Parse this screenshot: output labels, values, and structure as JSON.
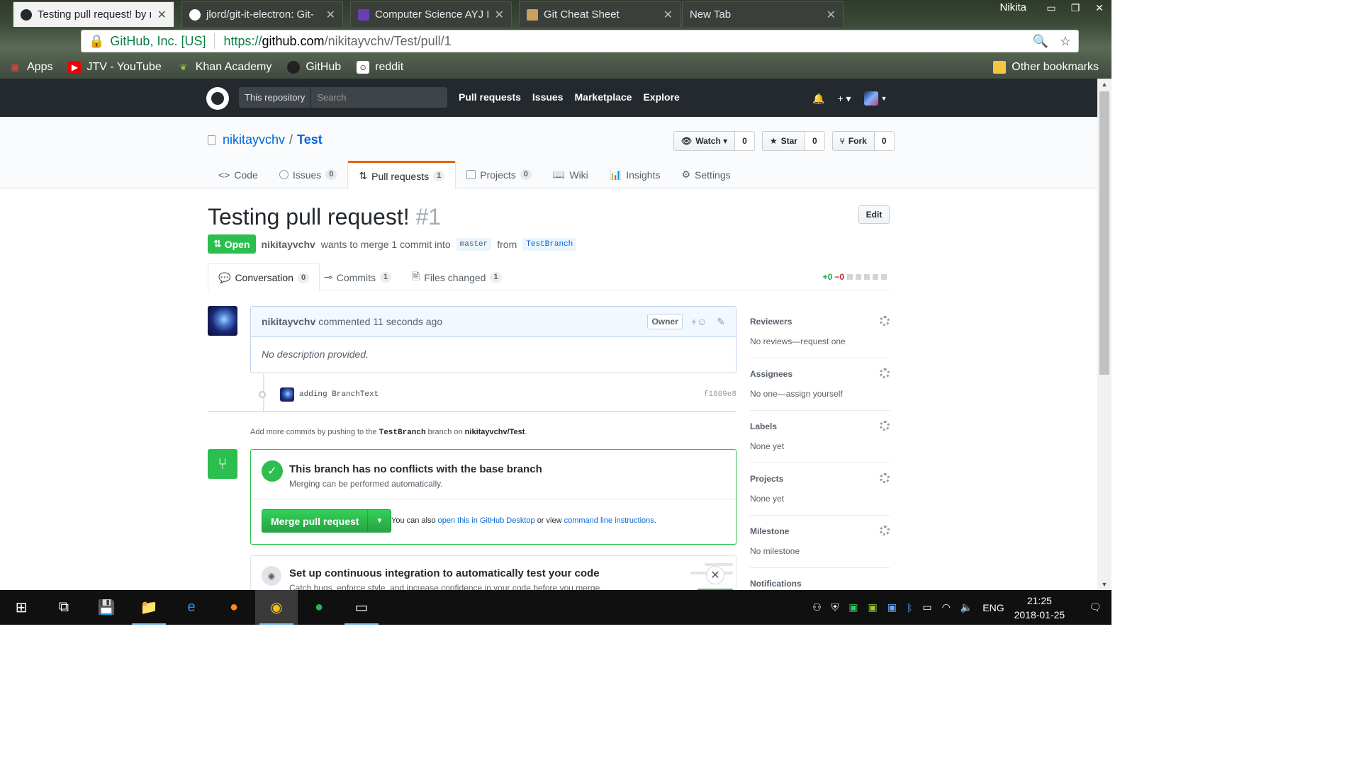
{
  "browser": {
    "tabs": [
      {
        "title": "Testing pull request! by n",
        "active": true
      },
      {
        "title": "jlord/git-it-electron: Git-",
        "active": false
      },
      {
        "title": "Computer Science AYJ IC",
        "active": false
      },
      {
        "title": "Git Cheat Sheet",
        "active": false
      },
      {
        "title": "New Tab",
        "active": false
      }
    ],
    "user": "Nikita",
    "secure_label": "GitHub, Inc. [US]",
    "url_scheme": "https://",
    "url_domain": "github.com",
    "url_path": "/nikitayvchv/Test/pull/1",
    "bookmarks": [
      "Apps",
      "JTV - YouTube",
      "Khan Academy",
      "GitHub",
      "reddit"
    ],
    "other_bookmarks": "Other bookmarks"
  },
  "gh_header": {
    "scope": "This repository",
    "search_placeholder": "Search",
    "nav": [
      "Pull requests",
      "Issues",
      "Marketplace",
      "Explore"
    ],
    "plus": "+ ▾"
  },
  "repo": {
    "owner": "nikitayvchv",
    "slash": "/",
    "name": "Test",
    "watch_label": "Watch ▾",
    "watch_count": "0",
    "star_label": "Star",
    "star_count": "0",
    "fork_label": "Fork",
    "fork_count": "0",
    "nav": [
      {
        "label": "Code",
        "count": ""
      },
      {
        "label": "Issues",
        "count": "0"
      },
      {
        "label": "Pull requests",
        "count": "1"
      },
      {
        "label": "Projects",
        "count": "0"
      },
      {
        "label": "Wiki",
        "count": ""
      },
      {
        "label": "Insights",
        "count": ""
      },
      {
        "label": "Settings",
        "count": ""
      }
    ]
  },
  "pr": {
    "title": "Testing pull request!",
    "number": "#1",
    "edit": "Edit",
    "state": "Open",
    "author": "nikitayvchv",
    "merge_text": "wants to merge 1 commit into",
    "base": "master",
    "from": "from",
    "head": "TestBranch",
    "tabs": [
      {
        "label": "Conversation",
        "count": "0"
      },
      {
        "label": "Commits",
        "count": "1"
      },
      {
        "label": "Files changed",
        "count": "1"
      }
    ],
    "additions": "+0",
    "deletions": "−0"
  },
  "comment": {
    "author": "nikitayvchv",
    "meta": "commented 11 seconds ago",
    "owner_badge": "Owner",
    "reaction": "+☺",
    "body": "No description provided."
  },
  "commit": {
    "message": "adding BranchText",
    "sha": "f1809e8"
  },
  "hint": {
    "pre": "Add more commits by pushing to the",
    "branch": "TestBranch",
    "mid": "branch on",
    "repo": "nikitayvchv/Test",
    "end": "."
  },
  "merge": {
    "heading": "This branch has no conflicts with the base branch",
    "sub": "Merging can be performed automatically.",
    "button": "Merge pull request",
    "alt_pre": "You can also",
    "alt_link1": "open this in GitHub Desktop",
    "alt_mid": "or view",
    "alt_link2": "command line instructions",
    "alt_end": "."
  },
  "ci": {
    "heading": "Set up continuous integration to automatically test your code",
    "sub": "Catch bugs, enforce style, and increase confidence in your code before you merge."
  },
  "sidebar": [
    {
      "label": "Reviewers",
      "value": "No reviews—request one"
    },
    {
      "label": "Assignees",
      "value": "No one—assign yourself"
    },
    {
      "label": "Labels",
      "value": "None yet"
    },
    {
      "label": "Projects",
      "value": "None yet"
    },
    {
      "label": "Milestone",
      "value": "No milestone"
    },
    {
      "label": "Notifications",
      "value": ""
    }
  ],
  "taskbar": {
    "time": "21:25",
    "date": "2018-01-25",
    "lang": "ENG"
  },
  "colors": {
    "accent_green": "#2cbe4e",
    "link_blue": "#0366d6",
    "tab_underline": "#e36209",
    "header_dark": "#24292e"
  }
}
